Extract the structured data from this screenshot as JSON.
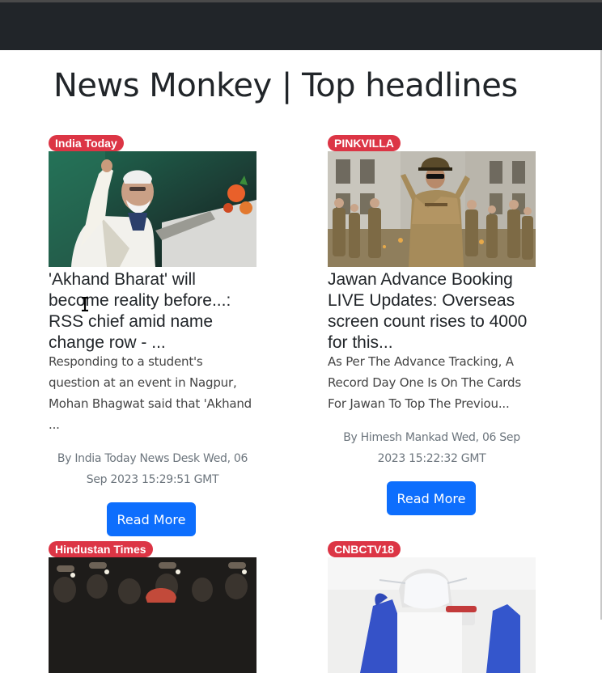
{
  "page": {
    "title": "News Monkey | Top headlines"
  },
  "colors": {
    "navbar": "#212529",
    "badge": "#dc3545",
    "button": "#0d6efd"
  },
  "articles": [
    {
      "source": "India Today",
      "title": "'Akhand Bharat' will become reality before...: RSS chief amid name change row - ...",
      "description": "Responding to a student's question at an event in Nagpur, Mohan Bhagwat said that 'Akhand ...",
      "byline": "By India Today News Desk Wed, 06 Sep 2023 15:29:51 GMT",
      "button": "Read More"
    },
    {
      "source": "PINKVILLA",
      "title": "Jawan Advance Booking LIVE Updates: Overseas screen count rises to 4000 for this...",
      "description": "As Per The Advance Tracking, A Record Day One Is On The Cards For Jawan To Top The Previou...",
      "byline": "By Himesh Mankad Wed, 06 Sep 2023 15:22:32 GMT",
      "button": "Read More"
    },
    {
      "source": "Hindustan Times"
    },
    {
      "source": "CNBCTV18"
    }
  ]
}
